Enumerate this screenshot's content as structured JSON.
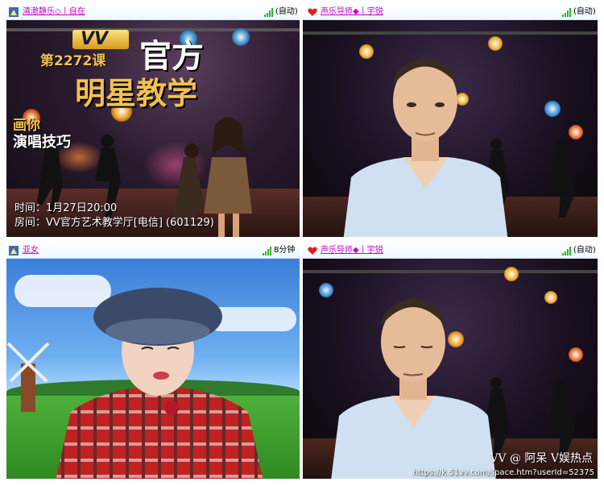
{
  "panels": {
    "top_left": {
      "username": "清澈静乐◇丨自在",
      "poster": {
        "brand": "VV",
        "lesson": "第2272课",
        "title_line1": "官方",
        "title_line2": "明星教学",
        "subtitle_line1": "画你",
        "subtitle_line2": "演唱技巧",
        "time": "时间：1月27日20:00",
        "room": "房间：VV官方艺术教学厅[电信] (601129)"
      }
    },
    "top_right": {
      "username": "声乐导师◆丨宇锐",
      "status": "(自动)"
    },
    "bottom_left": {
      "username": "亚女",
      "status": "8分钟"
    },
    "bottom_right": {
      "username": "声乐导师◆丨宇锐",
      "status": "(自动)",
      "watermark_main": "VV @ 阿呆  V娱热点",
      "watermark_url": "https://k.51vv.com/space.htm?userId=52375"
    }
  },
  "top_left_status": "(自动)",
  "colors": {
    "username": "#cc00cc",
    "signal": "#2db52d",
    "title_bar": "#eef7ff",
    "poster_gold": "#f2c14e"
  },
  "icons": [
    "user-avatar-icon",
    "heart-icon",
    "signal-icon"
  ]
}
